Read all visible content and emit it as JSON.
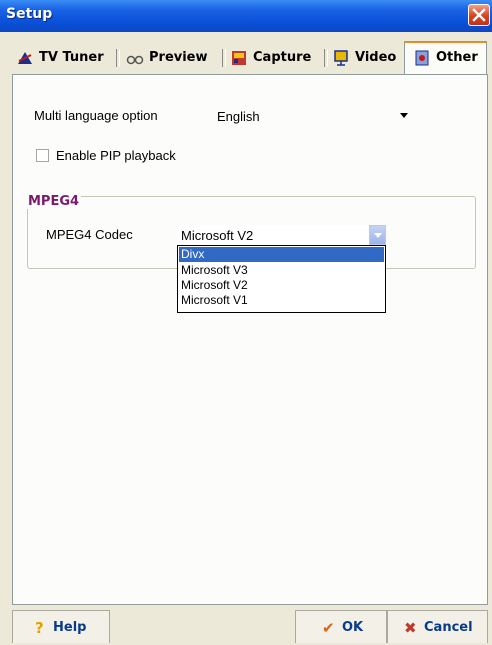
{
  "window": {
    "title": "Setup"
  },
  "tabs": [
    {
      "label": "TV Tuner",
      "icon": "satellite-dish-icon"
    },
    {
      "label": "Preview",
      "icon": "glasses-icon"
    },
    {
      "label": "Capture",
      "icon": "capture-icon"
    },
    {
      "label": "Video",
      "icon": "monitor-icon"
    },
    {
      "label": "Other",
      "icon": "settings-icon"
    }
  ],
  "active_tab": "Other",
  "other": {
    "language_label": "Multi language option",
    "language_value": "English",
    "pip_label": "Enable PIP playback",
    "pip_checked": false,
    "mpeg4_group_title": "MPEG4",
    "codec_label": "MPEG4 Codec",
    "codec_value": "Microsoft V2",
    "codec_options": [
      "Divx",
      "Microsoft V3",
      "Microsoft V2",
      "Microsoft V1"
    ],
    "codec_highlighted": "Divx"
  },
  "footer": {
    "help_label": "Help",
    "ok_label": "OK",
    "cancel_label": "Cancel"
  },
  "colors": {
    "titlebar": "#0a50d8",
    "group_title": "#7a1b6c",
    "button_text": "#0a3b8a",
    "selection": "#316ac5",
    "active_tab_accent": "#e68b2c"
  }
}
